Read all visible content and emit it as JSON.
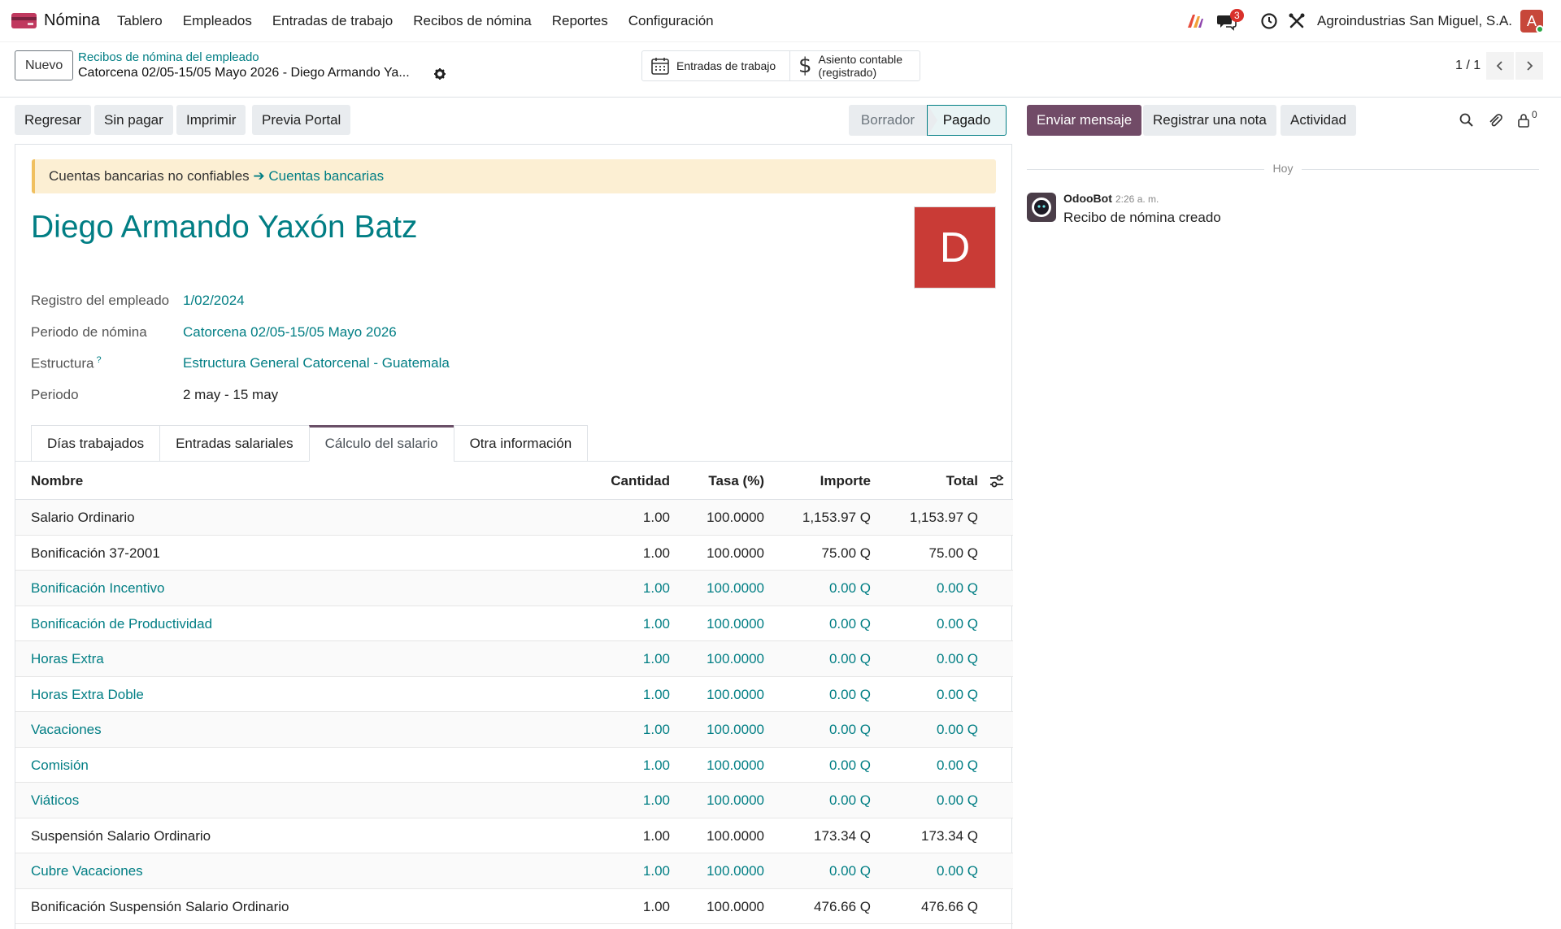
{
  "nav": {
    "app_name": "Nómina",
    "menu": [
      "Tablero",
      "Empleados",
      "Entradas de trabajo",
      "Recibos de nómina",
      "Reportes",
      "Configuración"
    ],
    "messages_count": "3",
    "company": "Agroindustrias San Miguel, S.A.",
    "user_initial": "A"
  },
  "control": {
    "new_label": "Nuevo",
    "breadcrumb_parent": "Recibos de nómina del empleado",
    "breadcrumb_current": "Catorcena 02/05-15/05 Mayo 2026 - Diego Armando Ya...",
    "smart_work_entries": "Entradas de trabajo",
    "smart_account_line1": "Asiento contable",
    "smart_account_line2": "(registrado)",
    "pager": "1 / 1"
  },
  "actions": {
    "back": "Regresar",
    "unpaid": "Sin pagar",
    "print": "Imprimir",
    "portal": "Previa Portal",
    "status_draft": "Borrador",
    "status_paid": "Pagado"
  },
  "form": {
    "alert_text": "Cuentas bancarias no confiables",
    "alert_arrow": "➔",
    "alert_link": "Cuentas bancarias",
    "employee_name": "Diego Armando Yaxón Batz",
    "avatar_initial": "D",
    "fields": {
      "registro_label": "Registro del empleado",
      "registro_value": "1/02/2024",
      "periodo_nomina_label": "Periodo de nómina",
      "periodo_nomina_value": "Catorcena 02/05-15/05 Mayo 2026",
      "estructura_label": "Estructura",
      "estructura_help": "?",
      "estructura_value": "Estructura General Catorcenal - Guatemala",
      "periodo_label": "Periodo",
      "periodo_value": "2 may - 15 may"
    },
    "tabs": [
      "Días trabajados",
      "Entradas salariales",
      "Cálculo del salario",
      "Otra información"
    ],
    "active_tab": "Cálculo del salario"
  },
  "table": {
    "headers": {
      "name": "Nombre",
      "qty": "Cantidad",
      "rate": "Tasa (%)",
      "amount": "Importe",
      "total": "Total"
    },
    "rows": [
      {
        "name": "Salario Ordinario",
        "qty": "1.00",
        "rate": "100.0000",
        "amount": "1,153.97 Q",
        "total": "1,153.97 Q",
        "linked": false
      },
      {
        "name": "Bonificación 37-2001",
        "qty": "1.00",
        "rate": "100.0000",
        "amount": "75.00 Q",
        "total": "75.00 Q",
        "linked": false
      },
      {
        "name": "Bonificación Incentivo",
        "qty": "1.00",
        "rate": "100.0000",
        "amount": "0.00 Q",
        "total": "0.00 Q",
        "linked": true
      },
      {
        "name": "Bonificación de Productividad",
        "qty": "1.00",
        "rate": "100.0000",
        "amount": "0.00 Q",
        "total": "0.00 Q",
        "linked": true
      },
      {
        "name": "Horas Extra",
        "qty": "1.00",
        "rate": "100.0000",
        "amount": "0.00 Q",
        "total": "0.00 Q",
        "linked": true
      },
      {
        "name": "Horas Extra Doble",
        "qty": "1.00",
        "rate": "100.0000",
        "amount": "0.00 Q",
        "total": "0.00 Q",
        "linked": true
      },
      {
        "name": "Vacaciones",
        "qty": "1.00",
        "rate": "100.0000",
        "amount": "0.00 Q",
        "total": "0.00 Q",
        "linked": true
      },
      {
        "name": "Comisión",
        "qty": "1.00",
        "rate": "100.0000",
        "amount": "0.00 Q",
        "total": "0.00 Q",
        "linked": true
      },
      {
        "name": "Viáticos",
        "qty": "1.00",
        "rate": "100.0000",
        "amount": "0.00 Q",
        "total": "0.00 Q",
        "linked": true
      },
      {
        "name": "Suspensión Salario Ordinario",
        "qty": "1.00",
        "rate": "100.0000",
        "amount": "173.34 Q",
        "total": "173.34 Q",
        "linked": false
      },
      {
        "name": "Cubre Vacaciones",
        "qty": "1.00",
        "rate": "100.0000",
        "amount": "0.00 Q",
        "total": "0.00 Q",
        "linked": true
      },
      {
        "name": "Bonificación Suspensión Salario Ordinario",
        "qty": "1.00",
        "rate": "100.0000",
        "amount": "476.66 Q",
        "total": "476.66 Q",
        "linked": false
      }
    ]
  },
  "chatter": {
    "send_message": "Enviar mensaje",
    "log_note": "Registrar una nota",
    "activity": "Actividad",
    "followers_count": "0",
    "day_label": "Hoy",
    "author": "OdooBot",
    "time": "2:26 a. m.",
    "message": "Recibo de nómina creado"
  },
  "colors": {
    "brand": "#714b67",
    "link": "#017e84",
    "alert_bg": "#fcefd3",
    "avatar": "#c93b36"
  },
  "icons": [
    "app-icon",
    "ai-icon",
    "chat-icon",
    "clock-icon",
    "tools-icon",
    "gear-icon",
    "calendar-icon",
    "dollar-icon",
    "chevron-left-icon",
    "chevron-right-icon",
    "settings-toggle-icon",
    "search-icon",
    "paperclip-icon",
    "lock-icon"
  ]
}
